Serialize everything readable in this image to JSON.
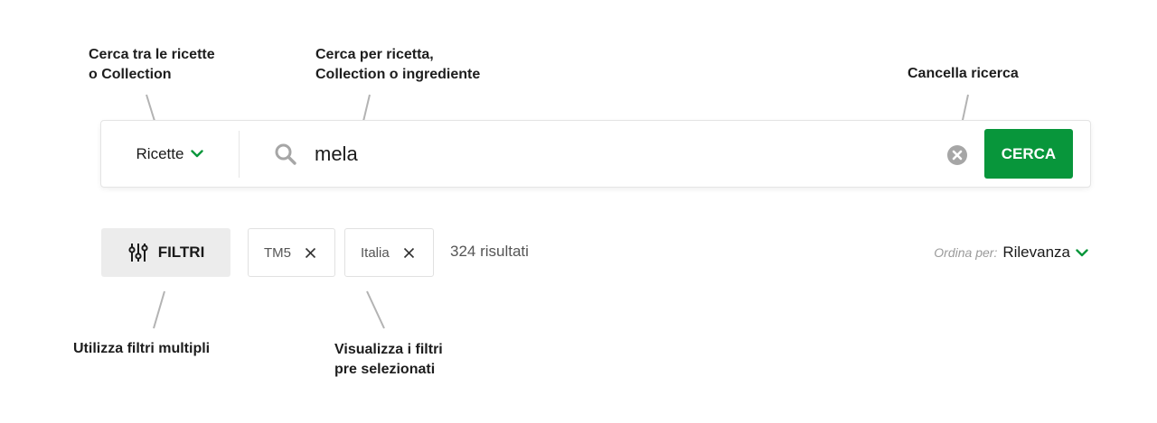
{
  "annotations": {
    "scope_help": [
      "Cerca tra le ricette",
      "o Collection"
    ],
    "query_help": [
      "Cerca per ricetta,",
      "Collection o ingrediente"
    ],
    "clear_help": "Cancella ricerca",
    "filters_help": "Utilizza filtri multipli",
    "chips_help": [
      "Visualizza i filtri",
      "pre selezionati"
    ]
  },
  "search": {
    "scope_label": "Ricette",
    "scope_icon": "chevron-down-icon",
    "query": "mela",
    "search_icon": "search-icon",
    "clear_icon": "clear-circle-icon",
    "submit_label": "CERCA"
  },
  "filters": {
    "button_label": "FILTRI",
    "button_icon": "sliders-icon",
    "chips": [
      {
        "label": "TM5"
      },
      {
        "label": "Italia"
      }
    ],
    "results_text": "324 risultati"
  },
  "sort": {
    "label": "Ordina per:",
    "value": "Rilevanza"
  },
  "colors": {
    "accent": "#08963b",
    "annotation_line": "#b3b3b3",
    "icon_grey": "#a6a6a6",
    "filter_bg": "#ececec"
  }
}
